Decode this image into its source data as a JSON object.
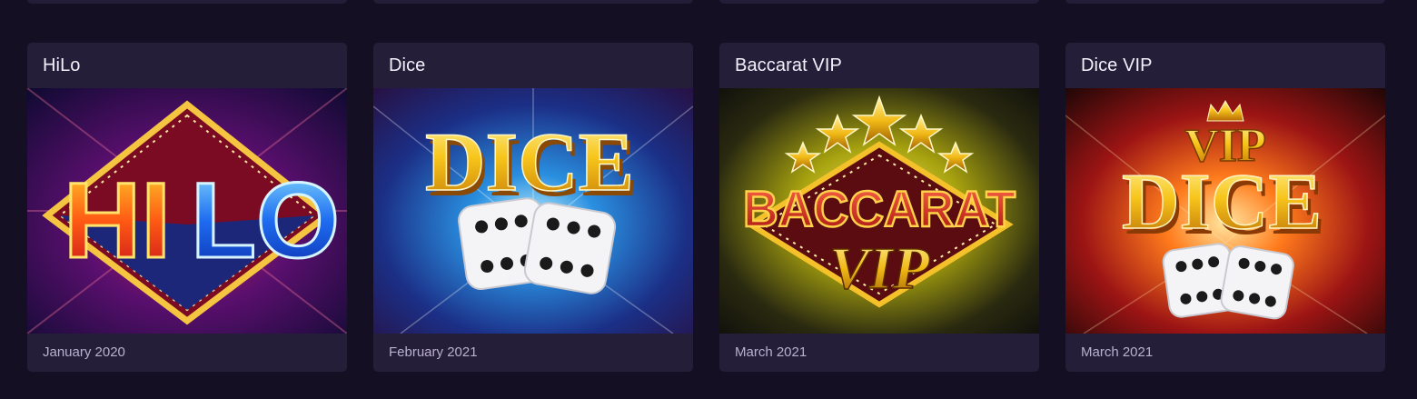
{
  "games": [
    {
      "title": "HiLo",
      "date": "January 2020",
      "art": {
        "line1": "HI",
        "line2": "LO"
      }
    },
    {
      "title": "Dice",
      "date": "February 2021",
      "art": {
        "line1": "DICE"
      }
    },
    {
      "title": "Baccarat VIP",
      "date": "March 2021",
      "art": {
        "line1": "BACCARAT",
        "line2": "VIP"
      }
    },
    {
      "title": "Dice VIP",
      "date": "March 2021",
      "art": {
        "line1": "VIP",
        "line2": "DICE"
      }
    }
  ],
  "colors": {
    "page_background": "#140f22",
    "card_background": "#251e39",
    "title_text": "#f3f0fb",
    "date_text": "#b8b1cd",
    "gold": "#f7c51b"
  }
}
